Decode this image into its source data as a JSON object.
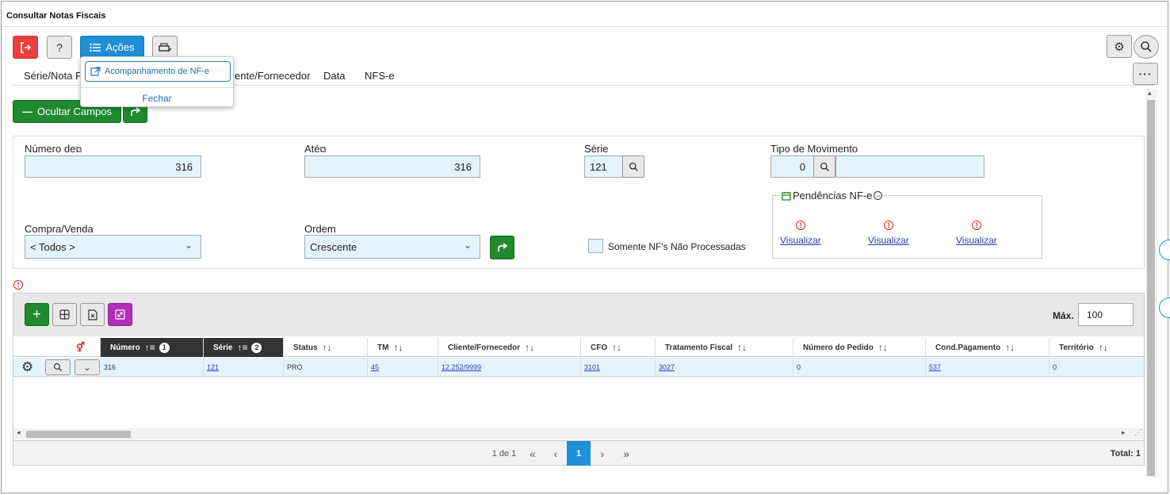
{
  "window": {
    "title": "Consultar Notas Fiscais"
  },
  "toolbar": {
    "acoes_label": "Ações",
    "help_label": "?"
  },
  "dropdown": {
    "item_label": "Acompanhamento de NF-e",
    "close_label": "Fechar"
  },
  "tabs": [
    "Série/Nota Fi",
    "ente/Fornecedor",
    "Data",
    "NFS-e"
  ],
  "filters": {
    "hide_fields_label": "Ocultar Campos",
    "numero_de_label": "Número de",
    "numero_de_value": "316",
    "ate_label": "Até",
    "ate_value": "316",
    "serie_label": "Série",
    "serie_value": "121",
    "tipo_mov_label": "Tipo de Movimento",
    "tipo_mov_value": "0",
    "compra_venda_label": "Compra/Venda",
    "compra_venda_value": "< Todos >",
    "ordem_label": "Ordem",
    "ordem_value": "Crescente",
    "somente_label": "Somente NF's Não Processadas",
    "pendencias_label": "Pendências NF-e",
    "visualizar": [
      "Visualizar",
      "Visualizar",
      "Visualizar"
    ]
  },
  "grid": {
    "max_label": "Máx.",
    "max_value": "100",
    "columns": [
      "Número",
      "Série",
      "Status",
      "TM",
      "Cliente/Fornecedor",
      "CFO",
      "Tratamento Fiscal",
      "Número do Pedido",
      "Cond.Pagamento",
      "Território"
    ],
    "sort_badges": [
      "1",
      "2"
    ],
    "row": {
      "numero": "316",
      "serie": "121",
      "status": "PRO",
      "tm": "45",
      "cliente": "12.252/9999",
      "cfo": "3101",
      "tratamento": "3027",
      "pedido": "0",
      "cond": "537",
      "territorio": "0"
    },
    "pager": {
      "info": "1 de 1",
      "first": "«",
      "prev": "‹",
      "page": "1",
      "next": "›",
      "last": "»",
      "total": "Total: 1"
    }
  }
}
